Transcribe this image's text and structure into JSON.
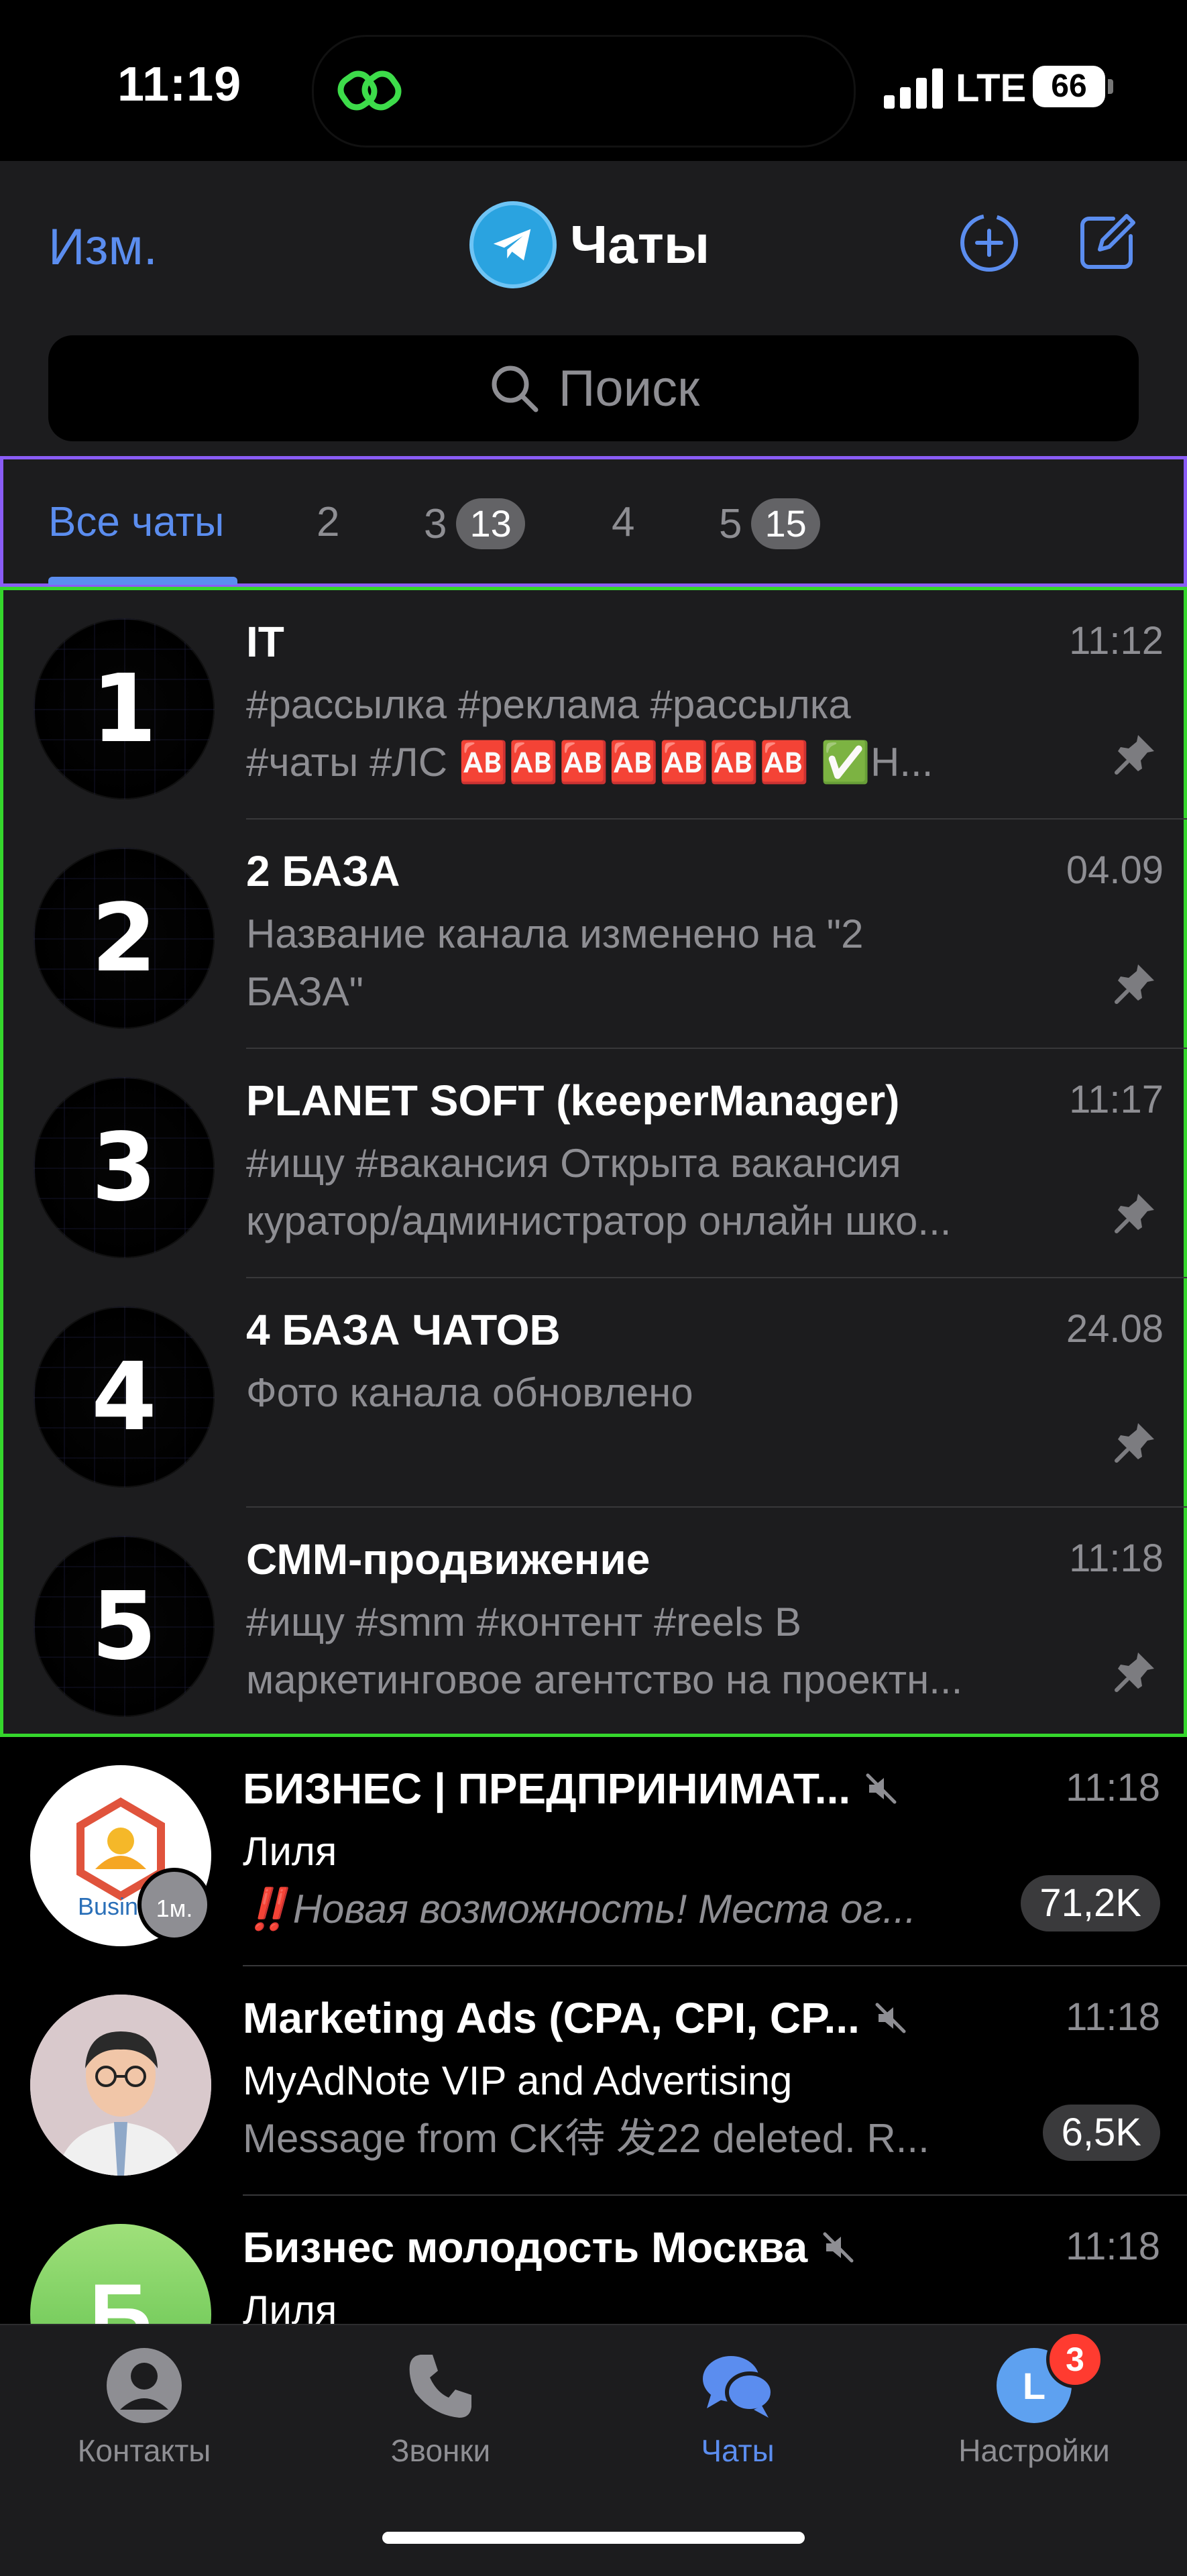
{
  "status": {
    "time": "11:19",
    "network": "LTE",
    "battery": "66"
  },
  "header": {
    "edit": "Изм.",
    "title": "Чаты"
  },
  "search": {
    "placeholder": "Поиск"
  },
  "tabs": [
    {
      "label": "Все чаты",
      "badge": ""
    },
    {
      "label": "2",
      "badge": ""
    },
    {
      "label": "3",
      "badge": "13"
    },
    {
      "label": "4",
      "badge": ""
    },
    {
      "label": "5",
      "badge": "15"
    }
  ],
  "pinned": [
    {
      "avatar": "1",
      "name": "IT",
      "time": "11:12",
      "line1": "#рассылка #реклама #рассылка",
      "line2": "#чаты #ЛС 🆎🆎🆎🆎🆎🆎🆎 ✅Н..."
    },
    {
      "avatar": "2",
      "name": "2 БАЗА",
      "time": "04.09",
      "line1": "Название канала изменено на \"2",
      "line2": "БАЗА\""
    },
    {
      "avatar": "3",
      "name": "PLANET SOFT (keeperManager)",
      "time": "11:17",
      "line1": "#ищу #вакансия Открыта вакансия",
      "line2": "куратор/администратор онлайн шко..."
    },
    {
      "avatar": "4",
      "name": "4 БАЗА ЧАТОВ",
      "time": "24.08",
      "line1": "Фото канала обновлено",
      "line2": ""
    },
    {
      "avatar": "5",
      "name": "СММ-продвижение",
      "time": "11:18",
      "line1": "#ищу #smm #контент #reels В",
      "line2": "маркетинговое агентство на проектн..."
    }
  ],
  "chats": [
    {
      "name": "БИЗНЕС | ПРЕДПРИНИМАТ...",
      "time": "11:18",
      "sender": "Лиля",
      "line": "‼️Новая возможность! Места ог...",
      "count": "71,2K",
      "avatar_text": "Busines",
      "avatar_badge": "1м."
    },
    {
      "name": "Marketing Ads (CPA, CPI, CP...",
      "time": "11:18",
      "sender": "MyAdNote VIP and Advertising",
      "line": "Message from CK待 发22 deleted. R...",
      "count": "6,5K"
    },
    {
      "name": "Бизнес молодость Москва",
      "time": "11:18",
      "sender": "Лиля",
      "avatar_text": "Б"
    }
  ],
  "tabbar": [
    {
      "label": "Контакты"
    },
    {
      "label": "Звонки"
    },
    {
      "label": "Чаты"
    },
    {
      "label": "Настройки"
    }
  ],
  "settings_badge": "3",
  "colors": {
    "accent": "#5b8def",
    "bg": "#000000",
    "panel": "#1c1c1e",
    "tabs_outline": "#8a5cf6",
    "pinned_outline": "#35d62c"
  }
}
